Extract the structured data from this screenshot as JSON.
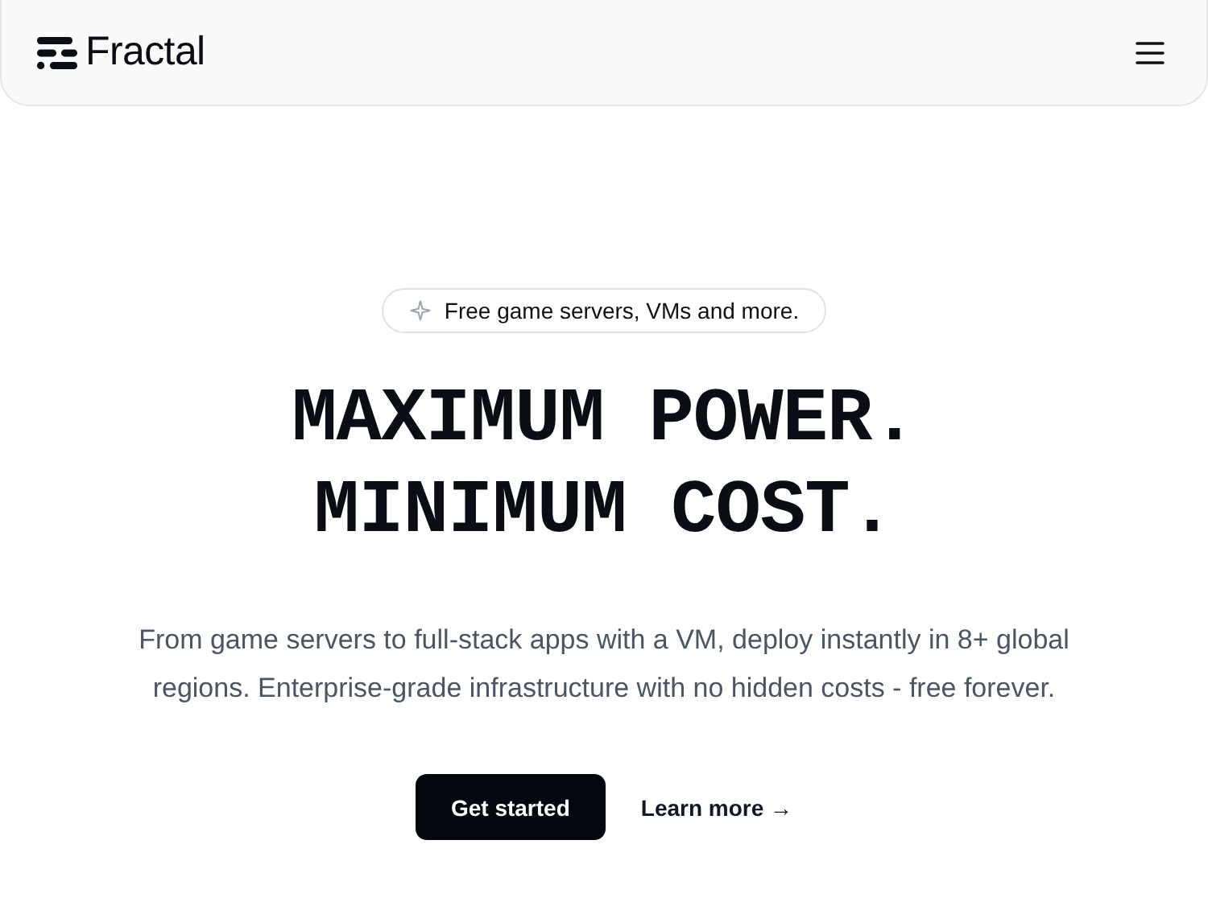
{
  "nav": {
    "brand": "Fractal"
  },
  "badge": {
    "text": "Free game servers, VMs and more."
  },
  "headline": [
    "MAXIMUM POWER.",
    "MINIMUM COST."
  ],
  "subtitle": "From game servers to full-stack apps with a VM, deploy instantly in 8+ global regions. Enterprise-grade infrastructure with no hidden costs - free forever.",
  "actions": [
    {
      "kind": "primary",
      "label": "Get started"
    },
    {
      "kind": "link",
      "label": "Learn more →"
    }
  ]
}
